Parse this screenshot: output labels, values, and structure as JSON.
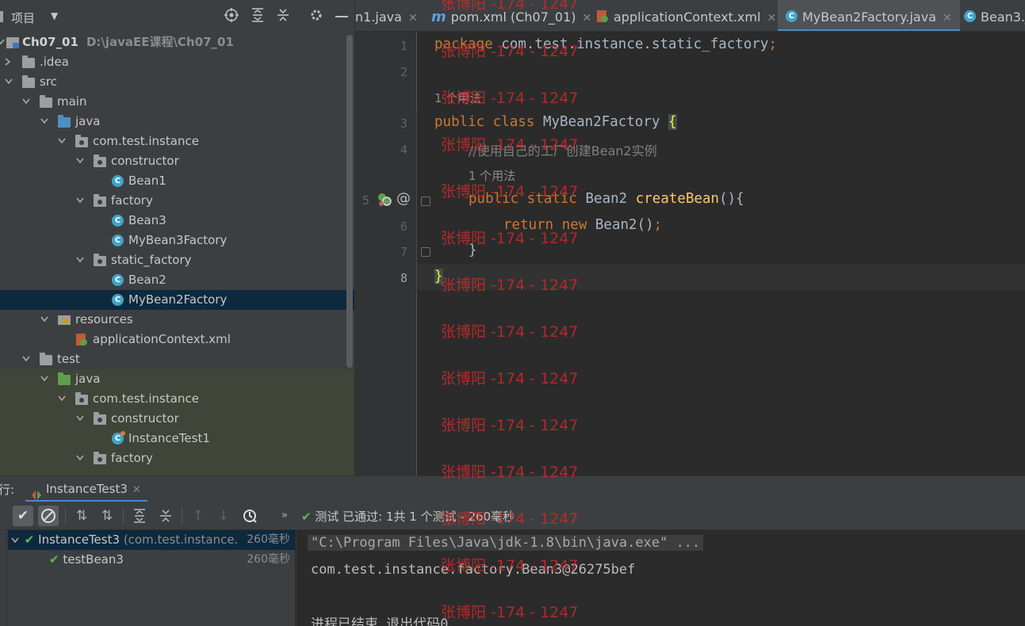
{
  "project": {
    "title": "项目",
    "tree": [
      {
        "label": "Ch07_01",
        "path": "D:\\javaEE课程\\Ch07_01"
      },
      {
        "label": ".idea"
      },
      {
        "label": "src"
      },
      {
        "label": "main"
      },
      {
        "label": "java"
      },
      {
        "label": "com.test.instance"
      },
      {
        "label": "constructor"
      },
      {
        "label": "Bean1"
      },
      {
        "label": "factory"
      },
      {
        "label": "Bean3"
      },
      {
        "label": "MyBean3Factory"
      },
      {
        "label": "static_factory"
      },
      {
        "label": "Bean2"
      },
      {
        "label": "MyBean2Factory"
      },
      {
        "label": "resources"
      },
      {
        "label": "applicationContext.xml"
      },
      {
        "label": "test"
      },
      {
        "label": "java"
      },
      {
        "label": "com.test.instance"
      },
      {
        "label": "constructor"
      },
      {
        "label": "InstanceTest1"
      },
      {
        "label": "factory"
      }
    ]
  },
  "tabs": [
    {
      "label": "n1.java"
    },
    {
      "label": "pom.xml (Ch07_01)"
    },
    {
      "label": "applicationContext.xml"
    },
    {
      "label": "MyBean2Factory.java"
    },
    {
      "label": "Bean3.j"
    }
  ],
  "editor": {
    "line_numbers": [
      "1",
      "2",
      "3",
      "4",
      "5",
      "6",
      "7",
      "8"
    ],
    "usage_hint_1": "1 个用法",
    "usage_hint_2": "1 个用法",
    "code": {
      "l1_kw": "package",
      "l1_rest": " com.test.instance.static_factory",
      "l1_semi": ";",
      "l3_kw": "public class",
      "l3_name": " MyBean2Factory ",
      "l3_brace": "{",
      "l4_comment": "//使用自己的工厂创建Bean2实例",
      "l5_kw": "public static",
      "l5_type": " Bean2 ",
      "l5_fn": "createBean",
      "l5_rest": "(){",
      "l6_kw": "return new",
      "l6_rest": " Bean2()",
      "l6_semi": ";",
      "l7": "}",
      "l8": "}"
    }
  },
  "watermark": "张博阳 -174 - 1247",
  "run": {
    "label": "行:",
    "tab": "InstanceTest3",
    "status_prefix": "测试 已通过:",
    "status_count": "1共 1 个测试 - 260毫秒",
    "tests": [
      {
        "name": "InstanceTest3",
        "sub": "(com.test.instance.",
        "time": "260毫秒"
      },
      {
        "name": "testBean3",
        "time": "260毫秒"
      }
    ],
    "console": [
      "\"C:\\Program Files\\Java\\jdk-1.8\\bin\\java.exe\" ...",
      "com.test.instance.factory.Bean3@26275bef",
      "进程已结束,退出代码0"
    ]
  },
  "colors": {
    "accent": "#4a88c7",
    "keyword": "#cc7832",
    "function": "#ffc66d",
    "pass": "#5fb85a"
  }
}
